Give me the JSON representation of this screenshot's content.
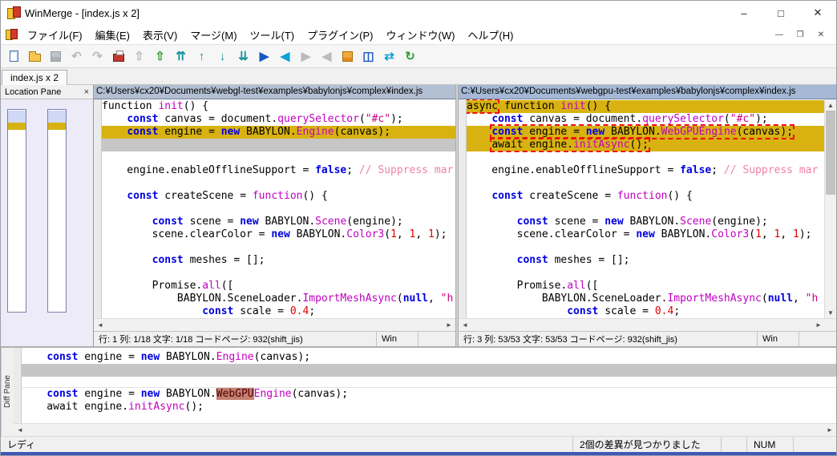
{
  "window": {
    "title": "WinMerge - [index.js x 2]",
    "minimize": "–",
    "maximize": "□",
    "close": "✕"
  },
  "mdi": {
    "minimize": "—",
    "restore": "❐",
    "close": "✕"
  },
  "menu": {
    "items": [
      "ファイル(F)",
      "編集(E)",
      "表示(V)",
      "マージ(M)",
      "ツール(T)",
      "プラグイン(P)",
      "ウィンドウ(W)",
      "ヘルプ(H)"
    ]
  },
  "toolbar": {
    "buttons": [
      {
        "name": "new-button",
        "shape": "page",
        "enabled": true
      },
      {
        "name": "open-button",
        "shape": "folder",
        "enabled": true
      },
      {
        "name": "save-button",
        "shape": "floppy",
        "enabled": false
      },
      {
        "name": "undo-button",
        "glyph": "↶",
        "color": "#b5b5b5",
        "enabled": false
      },
      {
        "name": "redo-button",
        "glyph": "↷",
        "color": "#b5b5b5",
        "enabled": false
      },
      {
        "name": "merge-mode-button",
        "shape": "printer",
        "enabled": true
      },
      {
        "name": "prev-file-button",
        "glyph": "⇧",
        "color": "#b5b5b5",
        "enabled": false
      },
      {
        "name": "next-file-button",
        "glyph": "⇧",
        "color": "#2f9e2f",
        "enabled": true
      },
      {
        "name": "first-diff-button",
        "glyph": "⇈",
        "color": "#15919b",
        "enabled": true
      },
      {
        "name": "prev-diff-button",
        "glyph": "↑",
        "color": "#15919b",
        "enabled": true
      },
      {
        "name": "next-diff-button",
        "glyph": "↓",
        "color": "#15919b",
        "enabled": true
      },
      {
        "name": "last-diff-button",
        "glyph": "⇊",
        "color": "#15919b",
        "enabled": true
      },
      {
        "name": "copy-right-button",
        "glyph": "▶",
        "color": "#1857c4",
        "enabled": true
      },
      {
        "name": "copy-left-button",
        "glyph": "◀",
        "color": "#0aa0d8",
        "enabled": true
      },
      {
        "name": "copy-right-advance-button",
        "glyph": "▶",
        "color": "#b5b5b5",
        "enabled": false
      },
      {
        "name": "copy-left-advance-button",
        "glyph": "◀",
        "color": "#b5b5b5",
        "enabled": false
      },
      {
        "name": "auto-merge-button",
        "shape": "grid",
        "enabled": true
      },
      {
        "name": "view-split-button",
        "glyph": "◫",
        "color": "#1857c4",
        "enabled": true
      },
      {
        "name": "swap-panes-button",
        "glyph": "⇄",
        "color": "#0aa0d8",
        "enabled": true
      },
      {
        "name": "refresh-button",
        "glyph": "↻",
        "color": "#2f9e2f",
        "enabled": true
      }
    ]
  },
  "tab_bar": {
    "tabs": [
      {
        "label": "index.js x 2"
      }
    ]
  },
  "location_pane": {
    "title": "Location Pane",
    "close": "×",
    "marks": [
      {
        "name": "view-area",
        "y": 1,
        "h": 15,
        "color": "#cfd9f6"
      },
      {
        "name": "current-diff",
        "y": 16,
        "h": 9,
        "color": "#d8b211"
      }
    ]
  },
  "panes": {
    "left": {
      "path": "C:¥Users¥cx20¥Documents¥webgl-test¥examples¥babylonjs¥complex¥index.js",
      "status": "行: 1  列: 1/18  文字: 1/18  コードページ: 932(shift_jis)",
      "eol": "Win",
      "lines": [
        {
          "t": [
            [
              "pl",
              "function "
            ],
            [
              "fn",
              "init"
            ],
            [
              "pl",
              "() {"
            ]
          ]
        },
        {
          "t": [
            [
              "pl",
              "    "
            ],
            [
              "kw",
              "const"
            ],
            [
              "pl",
              " canvas = document."
            ],
            [
              "fn",
              "querySelector"
            ],
            [
              "pl",
              "("
            ],
            [
              "str",
              "\"#c\""
            ],
            [
              "pl",
              ");"
            ]
          ]
        },
        {
          "bg": "diff",
          "t": [
            [
              "pl",
              "    "
            ],
            [
              "kw",
              "const"
            ],
            [
              "pl",
              " engine = "
            ],
            [
              "kw",
              "new"
            ],
            [
              "pl",
              " BABYLON."
            ],
            [
              "fn",
              "Engine"
            ],
            [
              "pl",
              "(canvas);"
            ]
          ]
        },
        {
          "bg": "ghost"
        },
        {},
        {
          "t": [
            [
              "pl",
              "    engine.enableOfflineSupport = "
            ],
            [
              "kw",
              "false"
            ],
            [
              "pl",
              "; "
            ],
            [
              "cm",
              "// Suppress mar"
            ]
          ]
        },
        {},
        {
          "t": [
            [
              "pl",
              "    "
            ],
            [
              "kw",
              "const"
            ],
            [
              "pl",
              " createScene = "
            ],
            [
              "fn",
              "function"
            ],
            [
              "pl",
              "() {"
            ]
          ]
        },
        {},
        {
          "t": [
            [
              "pl",
              "        "
            ],
            [
              "kw",
              "const"
            ],
            [
              "pl",
              " scene = "
            ],
            [
              "kw",
              "new"
            ],
            [
              "pl",
              " BABYLON."
            ],
            [
              "fn",
              "Scene"
            ],
            [
              "pl",
              "(engine);"
            ]
          ]
        },
        {
          "t": [
            [
              "pl",
              "        scene.clearColor = "
            ],
            [
              "kw",
              "new"
            ],
            [
              "pl",
              " BABYLON."
            ],
            [
              "fn",
              "Color3"
            ],
            [
              "pl",
              "("
            ],
            [
              "num",
              "1"
            ],
            [
              "pl",
              ", "
            ],
            [
              "num",
              "1"
            ],
            [
              "pl",
              ", "
            ],
            [
              "num",
              "1"
            ],
            [
              "pl",
              ");"
            ]
          ]
        },
        {},
        {
          "t": [
            [
              "pl",
              "        "
            ],
            [
              "kw",
              "const"
            ],
            [
              "pl",
              " meshes = [];"
            ]
          ]
        },
        {},
        {
          "t": [
            [
              "pl",
              "        Promise."
            ],
            [
              "fn",
              "all"
            ],
            [
              "pl",
              "(["
            ]
          ]
        },
        {
          "t": [
            [
              "pl",
              "            BABYLON.SceneLoader."
            ],
            [
              "fn",
              "ImportMeshAsync"
            ],
            [
              "pl",
              "("
            ],
            [
              "kw",
              "null"
            ],
            [
              "pl",
              ", "
            ],
            [
              "str",
              "\"h"
            ]
          ]
        },
        {
          "t": [
            [
              "pl",
              "                "
            ],
            [
              "kw",
              "const"
            ],
            [
              "pl",
              " scale = "
            ],
            [
              "num",
              "0.4"
            ],
            [
              "pl",
              ";"
            ]
          ]
        }
      ]
    },
    "right": {
      "path": "C:¥Users¥cx20¥Documents¥webgpu-test¥examples¥babylonjs¥complex¥index.js",
      "status": "行: 3  列: 53/53  文字: 53/53  コードページ: 932(shift_jis)",
      "eol": "Win",
      "lines": [
        {
          "bg": "diff",
          "t": [
            [
              "box",
              [
                [
                  "pl",
                  "async"
                ]
              ]
            ],
            [
              "pl",
              " function "
            ],
            [
              "fn",
              "init"
            ],
            [
              "pl",
              "() {"
            ]
          ]
        },
        {
          "t": [
            [
              "pl",
              "    "
            ],
            [
              "kw",
              "const"
            ],
            [
              "pl",
              " canvas = document."
            ],
            [
              "fn",
              "querySelector"
            ],
            [
              "pl",
              "("
            ],
            [
              "str",
              "\"#c\""
            ],
            [
              "pl",
              ");"
            ]
          ]
        },
        {
          "bg": "diff",
          "t": [
            [
              "pl",
              "    "
            ],
            [
              "box",
              [
                [
                  "kw",
                  "const"
                ],
                [
                  "pl",
                  " engine = "
                ],
                [
                  "kw",
                  "new"
                ],
                [
                  "pl",
                  " BABYLON."
                ],
                [
                  "fn",
                  "WebGPUEngine"
                ],
                [
                  "pl",
                  "(canvas);"
                ]
              ]
            ]
          ]
        },
        {
          "bg": "diff",
          "t": [
            [
              "pl",
              "    "
            ],
            [
              "box",
              [
                [
                  "pl",
                  "await engine."
                ],
                [
                  "fn",
                  "initAsync"
                ],
                [
                  "pl",
                  "();"
                ]
              ]
            ]
          ]
        },
        {},
        {
          "t": [
            [
              "pl",
              "    engine.enableOfflineSupport = "
            ],
            [
              "kw",
              "false"
            ],
            [
              "pl",
              "; "
            ],
            [
              "cm",
              "// Suppress mar"
            ]
          ]
        },
        {},
        {
          "t": [
            [
              "pl",
              "    "
            ],
            [
              "kw",
              "const"
            ],
            [
              "pl",
              " createScene = "
            ],
            [
              "fn",
              "function"
            ],
            [
              "pl",
              "() {"
            ]
          ]
        },
        {},
        {
          "t": [
            [
              "pl",
              "        "
            ],
            [
              "kw",
              "const"
            ],
            [
              "pl",
              " scene = "
            ],
            [
              "kw",
              "new"
            ],
            [
              "pl",
              " BABYLON."
            ],
            [
              "fn",
              "Scene"
            ],
            [
              "pl",
              "(engine);"
            ]
          ]
        },
        {
          "t": [
            [
              "pl",
              "        scene.clearColor = "
            ],
            [
              "kw",
              "new"
            ],
            [
              "pl",
              " BABYLON."
            ],
            [
              "fn",
              "Color3"
            ],
            [
              "pl",
              "("
            ],
            [
              "num",
              "1"
            ],
            [
              "pl",
              ", "
            ],
            [
              "num",
              "1"
            ],
            [
              "pl",
              ", "
            ],
            [
              "num",
              "1"
            ],
            [
              "pl",
              ");"
            ]
          ]
        },
        {},
        {
          "t": [
            [
              "pl",
              "        "
            ],
            [
              "kw",
              "const"
            ],
            [
              "pl",
              " meshes = [];"
            ]
          ]
        },
        {},
        {
          "t": [
            [
              "pl",
              "        Promise."
            ],
            [
              "fn",
              "all"
            ],
            [
              "pl",
              "(["
            ]
          ]
        },
        {
          "t": [
            [
              "pl",
              "            BABYLON.SceneLoader."
            ],
            [
              "fn",
              "ImportMeshAsync"
            ],
            [
              "pl",
              "("
            ],
            [
              "kw",
              "null"
            ],
            [
              "pl",
              ", "
            ],
            [
              "str",
              "\"h"
            ]
          ]
        },
        {
          "t": [
            [
              "pl",
              "                "
            ],
            [
              "kw",
              "const"
            ],
            [
              "pl",
              " scale = "
            ],
            [
              "num",
              "0.4"
            ],
            [
              "pl",
              ";"
            ]
          ]
        }
      ]
    }
  },
  "diff_pane": {
    "label": "Diff Pane",
    "sections": [
      {
        "lines": [
          {
            "t": [
              [
                "pl",
                "    "
              ],
              [
                "kw",
                "const"
              ],
              [
                "pl",
                " engine = "
              ],
              [
                "kw",
                "new"
              ],
              [
                "pl",
                " BABYLON."
              ],
              [
                "fn",
                "Engine"
              ],
              [
                "pl",
                "(canvas);"
              ]
            ]
          },
          {
            "bg": "ghost"
          }
        ]
      },
      {
        "lines": [
          {
            "t": [
              [
                "pl",
                "    "
              ],
              [
                "kw",
                "const"
              ],
              [
                "pl",
                " engine = "
              ],
              [
                "kw",
                "new"
              ],
              [
                "pl",
                " BABYLON."
              ],
              [
                "wd",
                "WebGPU"
              ],
              [
                "fn",
                "Engine"
              ],
              [
                "pl",
                "(canvas);"
              ]
            ]
          },
          {
            "t": [
              [
                "pl",
                "    await engine."
              ],
              [
                "fn",
                "initAsync"
              ],
              [
                "pl",
                "();"
              ]
            ]
          }
        ]
      }
    ]
  },
  "status_bar": {
    "ready": "レディ",
    "message": "2個の差異が見つかりました",
    "num": "NUM"
  },
  "icons": {
    "scroll_left": "◄",
    "scroll_right": "►",
    "scroll_up": "▲",
    "scroll_down": "▼"
  },
  "colors": {
    "diff_background": "#d8b211",
    "ghost_background": "#c6c6c6",
    "word_diff_background": "#c47f70",
    "annotation": "#ee1111"
  }
}
